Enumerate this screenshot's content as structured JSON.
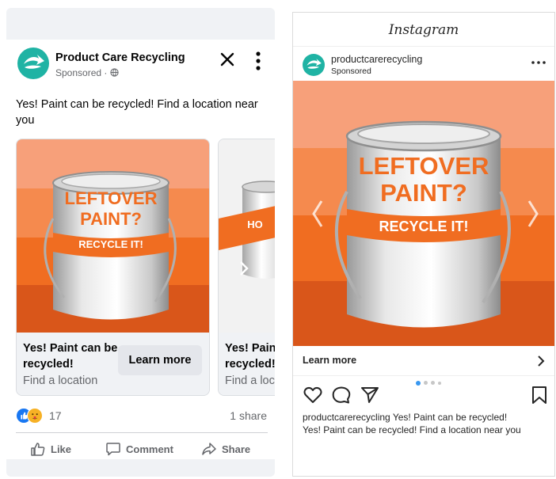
{
  "colors": {
    "brand_teal": "#1fb3a4",
    "orange_light": "#f7a07a",
    "orange_mid": "#f58a4e",
    "orange_strong": "#f06d21",
    "orange_dark": "#d9561a",
    "facebook_blue": "#1877f2"
  },
  "facebook": {
    "page_name": "Product Care Recycling",
    "sponsored": "Sponsored ·",
    "close_icon": "close-icon",
    "more_icon": "more-vertical-icon",
    "post_text": "Yes! Paint can be recycled! Find a location near you",
    "carousel": [
      {
        "can_text": {
          "line1": "LEFTOVER",
          "line2": "PAINT?",
          "band": "RECYCLE IT!"
        },
        "headline": "Yes! Paint can be recycled!",
        "subtitle": "Find a location",
        "cta": "Learn more"
      },
      {
        "can_text": {
          "line1": "HO"
        },
        "headline": "Yes! Paint can be recycled!",
        "subtitle": "Find a location"
      }
    ],
    "reactions_count": "17",
    "shares": "1 share",
    "actions": {
      "like": "Like",
      "comment": "Comment",
      "share": "Share"
    }
  },
  "instagram": {
    "wordmark": "Instagram",
    "username": "productcarerecycling",
    "sponsored": "Sponsored",
    "more_icon": "more-horizontal-icon",
    "can_text": {
      "line1": "LEFTOVER",
      "line2": "PAINT?",
      "band": "RECYCLE IT!"
    },
    "learn_more": "Learn more",
    "caption_user": "productcarerecycling",
    "caption_line1": "Yes! Paint can be recycled!",
    "caption_line2": "Yes! Paint can be recycled! Find a location near you",
    "carousel_position": {
      "current": 1,
      "total": 4
    }
  }
}
